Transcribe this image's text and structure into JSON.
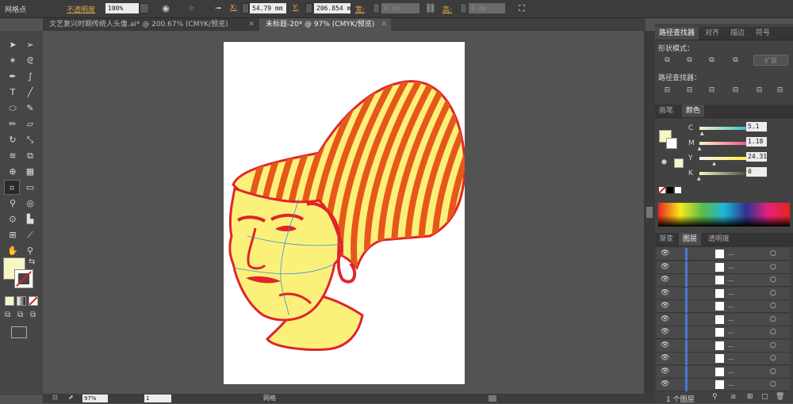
{
  "control_bar": {
    "selection_label": "网格点",
    "opacity_label": "不透明度",
    "opacity_value": "100%",
    "x_label": "X:",
    "x_value": "54.79 mm",
    "y_label": "Y:",
    "y_value": "206.854 m",
    "w_label": "宽:",
    "w_value": "0 mm",
    "h_label": "高:",
    "h_value": "0 mm"
  },
  "document_tabs": [
    {
      "label": "文艺复兴时期传统人头像.ai* @ 200.67% (CMYK/预览)",
      "active": false
    },
    {
      "label": "未标题-20* @ 97% (CMYK/预览)",
      "active": true
    }
  ],
  "panels": {
    "top_tabs": [
      "路径查找器",
      "对齐",
      "描边",
      "符号"
    ],
    "shape_modes_label": "形状模式：",
    "expand_label": "扩展",
    "pathfinders_label": "路径查找器：",
    "color_tabs": [
      "画笔",
      "颜色"
    ],
    "color": {
      "channels": [
        {
          "label": "C",
          "value": "5.1",
          "fraction": 0.05
        },
        {
          "label": "M",
          "value": "1.18",
          "fraction": 0.01
        },
        {
          "label": "Y",
          "value": "24.31",
          "fraction": 0.24
        },
        {
          "label": "K",
          "value": "0",
          "fraction": 0
        }
      ],
      "fill_color": "#f8f6c2"
    },
    "layer_tabs": [
      "渐变",
      "图层",
      "透明度"
    ],
    "layers_count_label": "1 个图层",
    "layer_rows": [
      "...",
      "...",
      "...",
      "...",
      "...",
      "...",
      "...",
      "...",
      "...",
      "...",
      "..."
    ]
  },
  "status_bar": {
    "zoom": "97%",
    "page": "1",
    "tool_name": "网格"
  },
  "artwork_colors": {
    "skin": "#fbf17a",
    "stroke": "#e0242a",
    "hat_stripe": "#e6581a",
    "mesh_line": "#3a8fd0"
  }
}
